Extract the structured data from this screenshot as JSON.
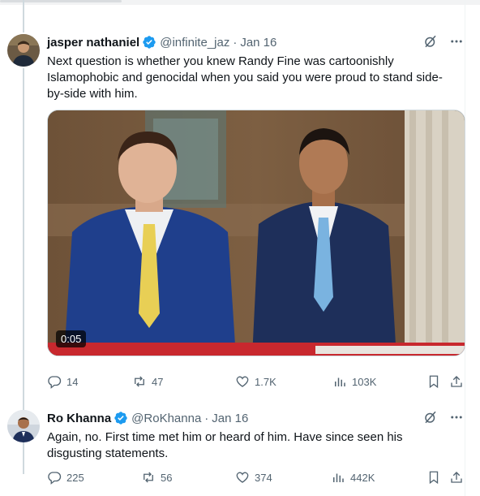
{
  "tweets": [
    {
      "name": "jasper nathaniel",
      "handle": "@infinite_jaz",
      "separator": "·",
      "date": "Jan 16",
      "text": "Next question is whether you knew Randy Fine was cartoonishly Islamophobic and genocidal when you said you were proud to stand side-by-side with him.",
      "video_time": "0:05",
      "stats": {
        "replies": "14",
        "reposts": "47",
        "likes": "1.7K",
        "views": "103K"
      }
    },
    {
      "name": "Ro Khanna",
      "handle": "@RoKhanna",
      "separator": "·",
      "date": "Jan 16",
      "text": "Again, no. First time met him or heard of him. Have since seen his disgusting statements.",
      "stats": {
        "replies": "225",
        "reposts": "56",
        "likes": "374",
        "views": "442K"
      }
    }
  ],
  "icons": {
    "verified": "verified-badge-icon",
    "grok": "grok-icon",
    "more": "more-icon",
    "reply": "reply-icon",
    "repost": "repost-icon",
    "like": "like-icon",
    "views": "views-icon",
    "bookmark": "bookmark-icon",
    "share": "share-icon"
  },
  "colors": {
    "verified": "#1d9bf0",
    "text": "#0f1419",
    "muted": "#536471",
    "border": "#cfd9de"
  }
}
